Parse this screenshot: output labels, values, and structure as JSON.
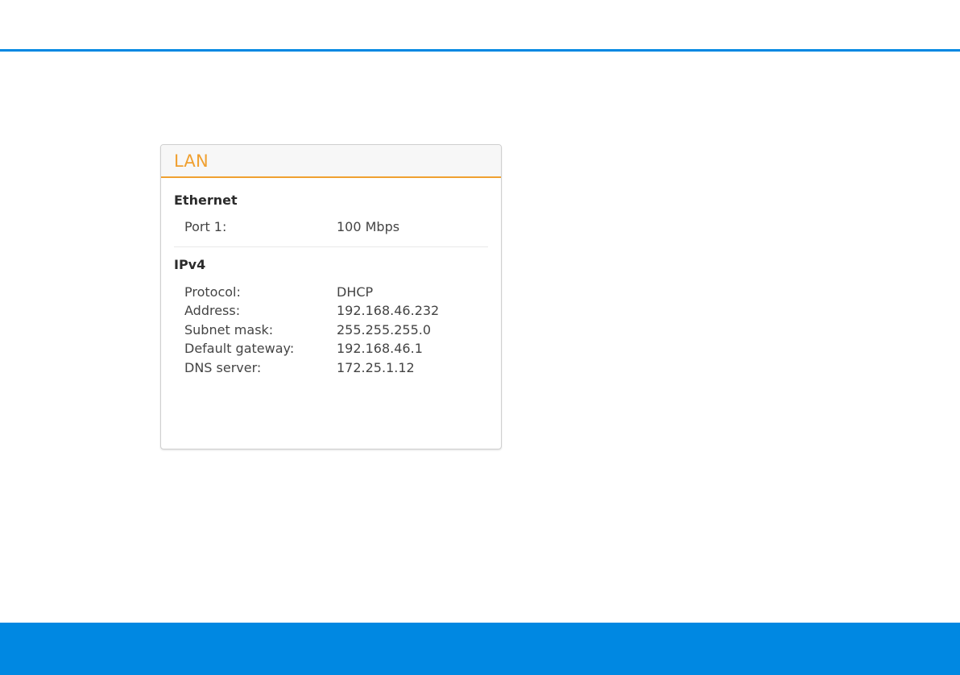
{
  "colors": {
    "brand_blue": "#0088e2",
    "accent_orange": "#f0a030",
    "title_orange": "#f0a030"
  },
  "panel": {
    "title": "LAN",
    "ethernet": {
      "heading": "Ethernet",
      "rows": [
        {
          "label": "Port 1:",
          "value": "100 Mbps"
        }
      ]
    },
    "ipv4": {
      "heading": "IPv4",
      "rows": [
        {
          "label": "Protocol:",
          "value": "DHCP"
        },
        {
          "label": "Address:",
          "value": "192.168.46.232"
        },
        {
          "label": "Subnet mask:",
          "value": "255.255.255.0"
        },
        {
          "label": "Default gateway:",
          "value": "192.168.46.1"
        },
        {
          "label": "DNS server:",
          "value": "172.25.1.12"
        }
      ]
    }
  }
}
